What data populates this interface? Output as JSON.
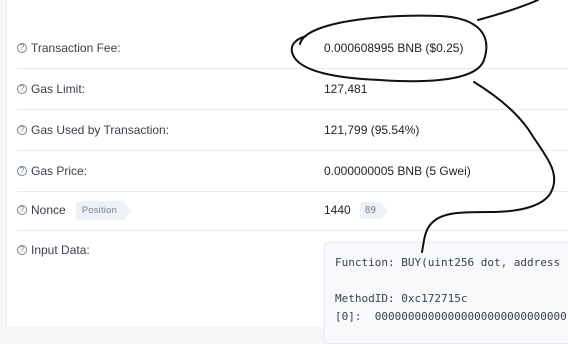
{
  "rows": [
    {
      "label": "Transaction Fee:",
      "value": "0.000608995 BNB ($0.25)"
    },
    {
      "label": "Gas Limit:",
      "value": "127,481"
    },
    {
      "label": "Gas Used by Transaction:",
      "value": "121,799 (95.54%)"
    },
    {
      "label": "Gas Price:",
      "value": "0.000000005 BNB (5 Gwei)"
    },
    {
      "label": "Nonce",
      "tag": "Position",
      "value": "1440",
      "value_tag": "89"
    }
  ],
  "input_data": {
    "label": "Input Data:",
    "lines": [
      "Function: BUY(uint256 dot, address",
      "",
      "MethodID: 0xc172715c",
      "[0]:  00000000000000000000000000000"
    ]
  },
  "help_icon_glyph": "?",
  "colors": {
    "ink": "#111111",
    "border": "#e7eaf3",
    "label": "#3b4048",
    "tag_bg": "#eef1f5"
  }
}
